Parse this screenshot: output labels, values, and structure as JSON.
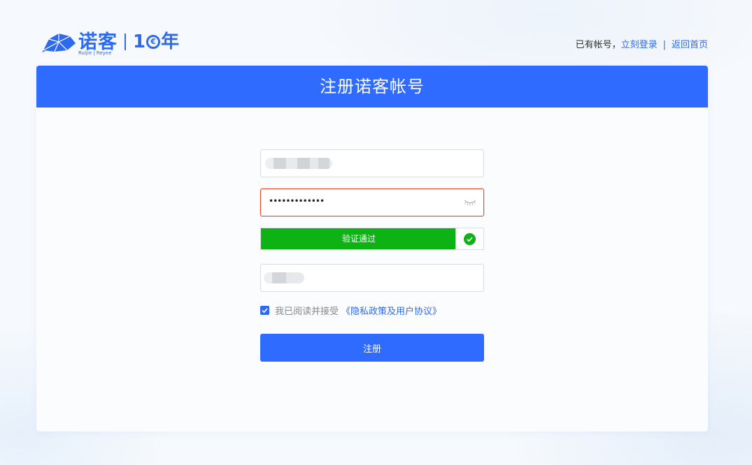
{
  "header": {
    "logo_cn": "诺客",
    "logo_sub": "Ruijie | Reyee",
    "logo_years_prefix": "1",
    "logo_years_mid": "€",
    "logo_years_suffix": "年",
    "have_account": "已有帐号，",
    "login_link": "立刻登录",
    "separator": "|",
    "home_link": "返回首页"
  },
  "form": {
    "title": "注册诺客帐号",
    "password_value": "•••••••••••••",
    "verify_text": "验证通过",
    "verify_progress": 1.0,
    "agree_checked": true,
    "agree_text": "我已阅读并接受",
    "agree_link": "《隐私政策及用户协议》",
    "submit_label": "注册"
  },
  "colors": {
    "brand": "#2f6bff",
    "success": "#0db215",
    "error_border": "#e64a2e"
  },
  "icons": [
    "ruijie-logo-icon",
    "eye-closed-icon",
    "check-circle-icon",
    "checkbox-checked-icon"
  ]
}
